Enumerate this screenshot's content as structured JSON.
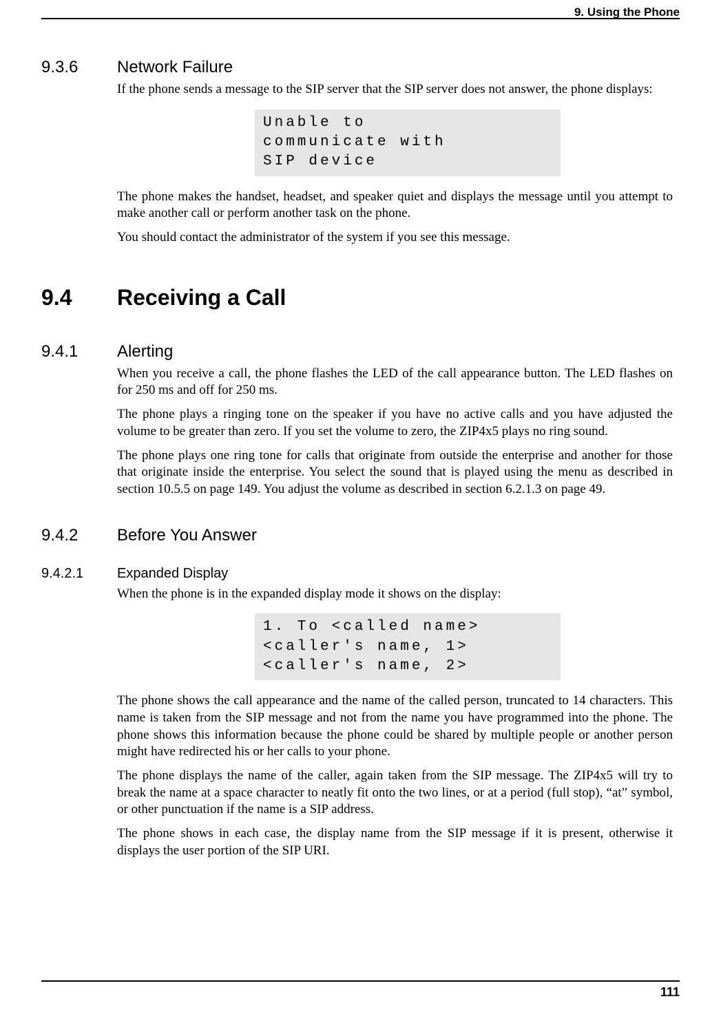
{
  "header": {
    "chapter": "9. Using the Phone"
  },
  "s936": {
    "num": "9.3.6",
    "title": "Network Failure",
    "p1": "If the phone sends a message to the SIP server that the SIP server does not answer, the phone displays:",
    "lcd": "Unable to\ncommunicate with\nSIP device",
    "p2": "The phone makes the handset, headset, and speaker quiet and displays the message until you attempt to make another call or perform another task on the phone.",
    "p3": "You should contact the administrator of the system if you see this message."
  },
  "s94": {
    "num": "9.4",
    "title": "Receiving a Call"
  },
  "s941": {
    "num": "9.4.1",
    "title": "Alerting",
    "p1": "When you receive a call, the phone flashes the LED of the call appearance button. The LED flashes on for 250 ms and off for 250 ms.",
    "p2": "The phone plays a ringing tone on the speaker if you have no active calls and you have adjusted the volume to be greater than zero. If you set the volume to zero, the ZIP4x5 plays no ring sound.",
    "p3": "The phone plays one ring tone for calls that originate from outside the enterprise and another for those that originate inside the enterprise. You select the sound that is played using the menu as described in section 10.5.5 on page 149. You adjust the volume as described in section 6.2.1.3 on page 49."
  },
  "s942": {
    "num": "9.4.2",
    "title": "Before You Answer"
  },
  "s9421": {
    "num": "9.4.2.1",
    "title": "Expanded Display",
    "p1": "When the phone is in the expanded display mode it shows on the display:",
    "lcd": "1. To <called name>\n<caller's name, 1>\n<caller's name, 2>",
    "p2": "The phone shows the call appearance and the name of the called person, truncated to 14 characters. This name is taken from the SIP message and not from the name you have programmed into the phone. The phone shows this information because the phone could be shared by multiple people or another person might have redirected his or her calls to your phone.",
    "p3": "The phone displays the name of the caller, again taken from the SIP message. The ZIP4x5 will try to break the name at a space character to neatly fit onto the two lines, or at a period (full stop), “at” symbol, or other punctuation if the name is a SIP address.",
    "p4": "The phone shows in each case, the display name from the SIP message if it is present, otherwise it displays the user portion of the SIP URI."
  },
  "footer": {
    "page": "111"
  }
}
